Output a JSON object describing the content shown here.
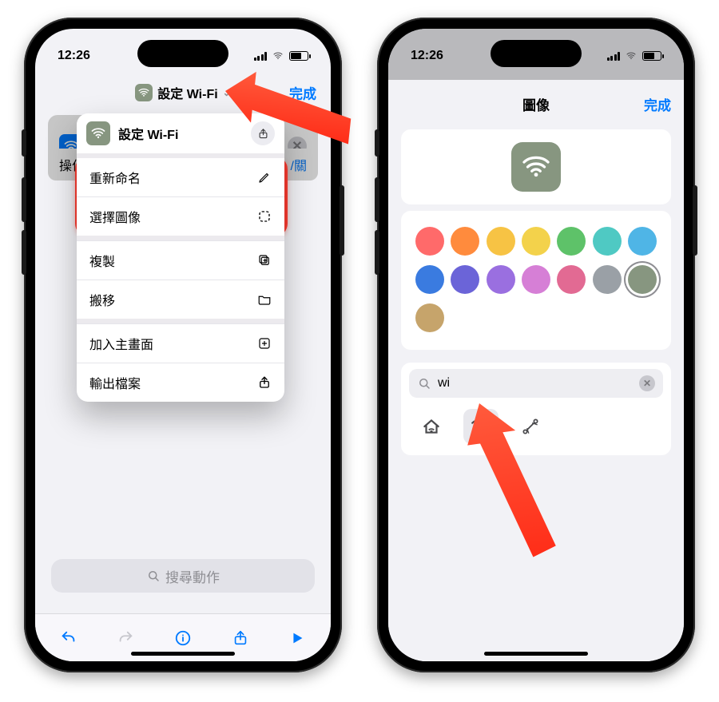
{
  "status": {
    "time": "12:26"
  },
  "left": {
    "header": {
      "shortcut_title": "設定 Wi-Fi",
      "done": "完成"
    },
    "popover": {
      "title": "設定 Wi-Fi",
      "share_icon": "share-icon",
      "items": {
        "rename": "重新命名",
        "choose_image": "選擇圖像",
        "duplicate": "複製",
        "move": "搬移",
        "add_home": "加入主畫面",
        "export": "輸出檔案"
      }
    },
    "background": {
      "action_label": "操作",
      "toggle_suffix": "/關"
    },
    "search_placeholder": "搜尋動作",
    "toolbar": {
      "undo": "undo-icon",
      "redo": "redo-icon",
      "info": "info-icon",
      "share": "share-icon",
      "play": "play-icon"
    }
  },
  "right": {
    "sheet_title": "圖像",
    "done": "完成",
    "colors": [
      "#ff6a6a",
      "#ff8b3d",
      "#f7c344",
      "#f3d24b",
      "#5ec269",
      "#4fc9c3",
      "#4fb5e6",
      "#3a7be0",
      "#6b64d8",
      "#9a6fe0",
      "#d67fd6",
      "#e26a93",
      "#9aa0a6",
      "#879680",
      "#c6a46b"
    ],
    "selected_color_index": 13,
    "search_value": "wi",
    "result_icons": [
      "home-wifi-icon",
      "wifi-icon",
      "wired-network-icon"
    ],
    "selected_result_index": 1
  }
}
